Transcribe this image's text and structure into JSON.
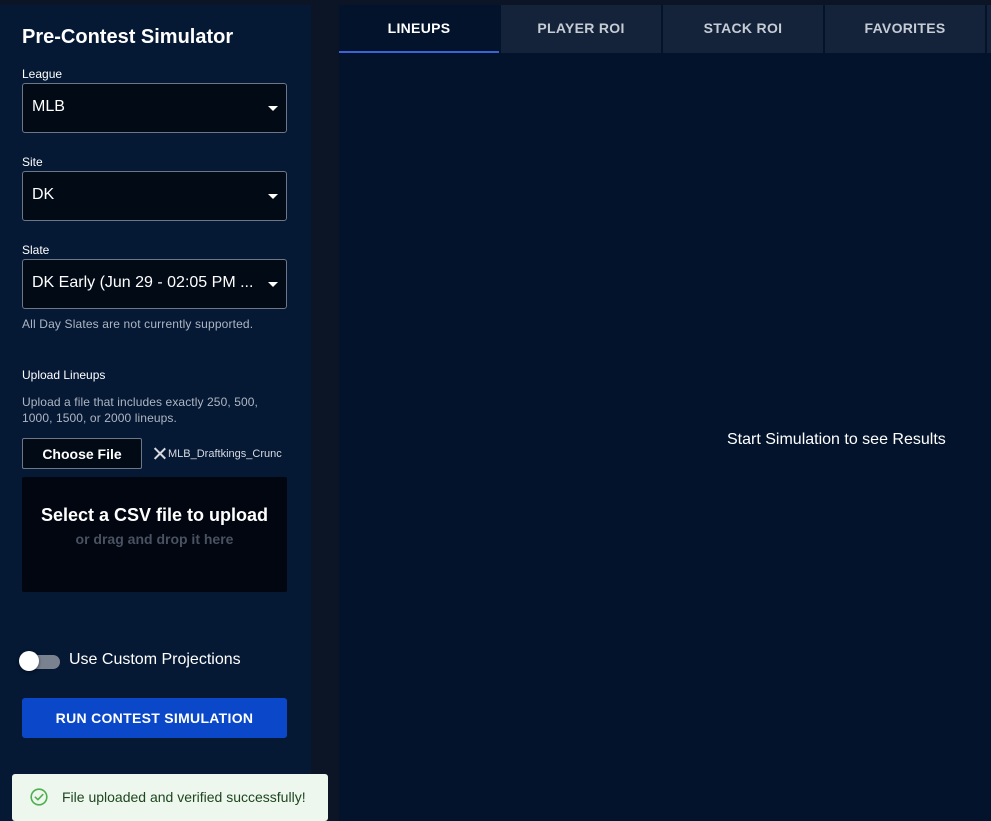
{
  "sidebar": {
    "title": "Pre-Contest Simulator",
    "league": {
      "label": "League",
      "value": "MLB"
    },
    "site": {
      "label": "Site",
      "value": "DK"
    },
    "slate": {
      "label": "Slate",
      "value": "DK Early (Jun 29 - 02:05 PM ...",
      "helper": "All Day Slates are not currently supported."
    },
    "upload": {
      "label": "Upload Lineups",
      "description": "Upload a file that includes exactly 250, 500, 1000, 1500, or 2000 lineups.",
      "choose_file_label": "Choose File",
      "file_name": "MLB_Draftkings_Crunc",
      "dropzone_title": "Select a CSV file to upload",
      "dropzone_subtitle": "or drag and drop it here"
    },
    "custom_projections": {
      "label": "Use Custom Projections",
      "enabled": false
    },
    "run_button_label": "RUN CONTEST SIMULATION"
  },
  "tabs": [
    {
      "label": "LINEUPS",
      "active": true
    },
    {
      "label": "PLAYER ROI",
      "active": false
    },
    {
      "label": "STACK ROI",
      "active": false
    },
    {
      "label": "FAVORITES",
      "active": false
    }
  ],
  "main": {
    "empty_message": "Start Simulation to see Results"
  },
  "toast": {
    "message": "File uploaded and verified successfully!",
    "icon": "check-circle-icon"
  },
  "colors": {
    "primary_button": "#0a47c9",
    "tab_indicator": "#3d62d6",
    "toast_bg": "#edf7ed",
    "toast_icon": "#4caf50"
  }
}
